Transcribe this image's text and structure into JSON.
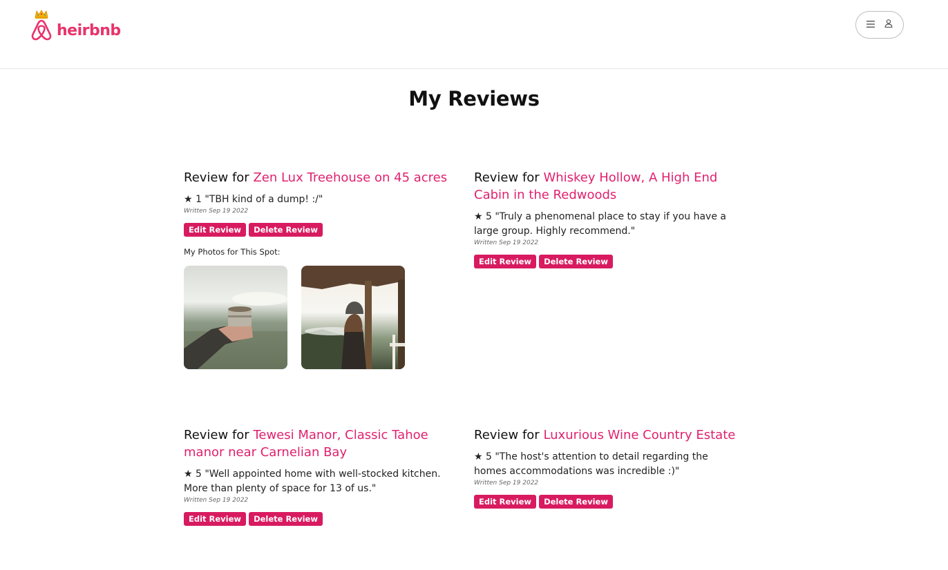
{
  "brand": {
    "name": "heirbnb",
    "accent": "#e8336b",
    "button_color": "#d81b60"
  },
  "header": {
    "menu_icon": "hamburger-icon",
    "user_icon": "user-icon"
  },
  "page": {
    "title": "My Reviews"
  },
  "reviews": [
    {
      "prefix": "Review for",
      "spot": "Zen Lux Treehouse on 45 acres",
      "rating_text": "★ 1 \"TBH kind of a dump! :/\"",
      "written": "Written Sep 19 2022",
      "edit_label": "Edit Review",
      "delete_label": "Delete Review",
      "photos_label": "My Photos for This Spot:",
      "photos": [
        "hand-holding-cup-photo",
        "person-on-porch-photo"
      ]
    },
    {
      "prefix": "Review for",
      "spot": "Whiskey Hollow, A High End Cabin in the Redwoods",
      "rating_text": "★ 5 \"Truly a phenomenal place to stay if you have a large group. Highly recommend.\"",
      "written": "Written Sep 19 2022",
      "edit_label": "Edit Review",
      "delete_label": "Delete Review"
    },
    {
      "prefix": "Review for",
      "spot": "Tewesi Manor, Classic Tahoe manor near Carnelian Bay",
      "rating_text": "★ 5 \"Well appointed home with well-stocked kitchen. More than plenty of space for 13 of us.\"",
      "written": "Written Sep 19 2022",
      "edit_label": "Edit Review",
      "delete_label": "Delete Review"
    },
    {
      "prefix": "Review for",
      "spot": "Luxurious Wine Country Estate",
      "rating_text": "★ 5 \"The host's attention to detail regarding the homes accommodations was incredible :)\"",
      "written": "Written Sep 19 2022",
      "edit_label": "Edit Review",
      "delete_label": "Delete Review"
    }
  ]
}
